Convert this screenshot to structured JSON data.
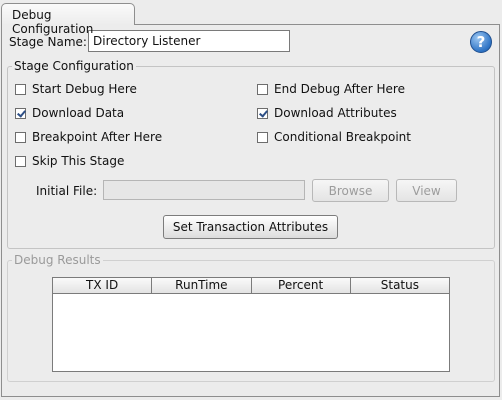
{
  "tab": {
    "label": "Debug Configuration"
  },
  "stage_name": {
    "label": "Stage Name:",
    "value": "Directory Listener"
  },
  "help": {
    "glyph": "?"
  },
  "stage_config": {
    "title": "Stage Configuration",
    "checkboxes": [
      {
        "label": "Start Debug Here",
        "checked": false
      },
      {
        "label": "End Debug After Here",
        "checked": false
      },
      {
        "label": "Download Data",
        "checked": true
      },
      {
        "label": "Download Attributes",
        "checked": true
      },
      {
        "label": "Breakpoint After Here",
        "checked": false
      },
      {
        "label": "Conditional Breakpoint",
        "checked": false
      },
      {
        "label": "Skip This Stage",
        "checked": false
      }
    ],
    "initial_file": {
      "label": "Initial File:",
      "value": ""
    },
    "browse_label": "Browse",
    "view_label": "View",
    "set_attributes_label": "Set Transaction Attributes"
  },
  "debug_results": {
    "title": "Debug Results",
    "columns": [
      "TX ID",
      "RunTime",
      "Percent",
      "Status"
    ]
  }
}
